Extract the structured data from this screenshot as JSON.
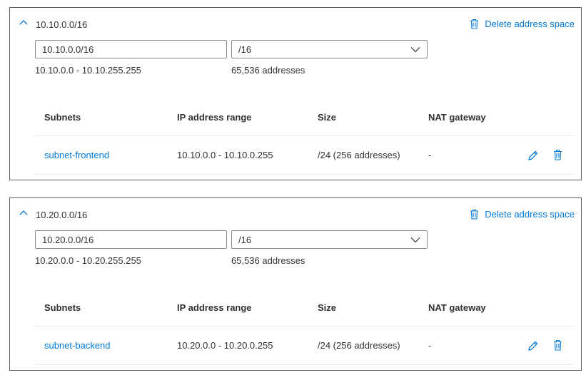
{
  "address_spaces": [
    {
      "title": "10.10.0.0/16",
      "delete_label": "Delete address space",
      "address_value": "10.10.0.0/16",
      "prefix": "/16",
      "range": "10.10.0.0 - 10.10.255.255",
      "count": "65,536 addresses",
      "columns": [
        "Subnets",
        "IP address range",
        "Size",
        "NAT gateway"
      ],
      "subnets": [
        {
          "name": "subnet-frontend",
          "ip_range": "10.10.0.0 - 10.10.0.255",
          "size": "/24 (256 addresses)",
          "nat": "-"
        }
      ]
    },
    {
      "title": "10.20.0.0/16",
      "delete_label": "Delete address space",
      "address_value": "10.20.0.0/16",
      "prefix": "/16",
      "range": "10.20.0.0 - 10.20.255.255",
      "count": "65,536 addresses",
      "columns": [
        "Subnets",
        "IP address range",
        "Size",
        "NAT gateway"
      ],
      "subnets": [
        {
          "name": "subnet-backend",
          "ip_range": "10.20.0.0 - 10.20.0.255",
          "size": "/24 (256 addresses)",
          "nat": "-"
        }
      ]
    }
  ],
  "icons": {
    "collapse": "chevron-up-icon",
    "delete": "trash-icon",
    "edit": "pencil-icon",
    "dropdown": "chevron-down-icon"
  },
  "colors": {
    "accent": "#0078d4",
    "text": "#323130",
    "border": "#8a8886"
  }
}
